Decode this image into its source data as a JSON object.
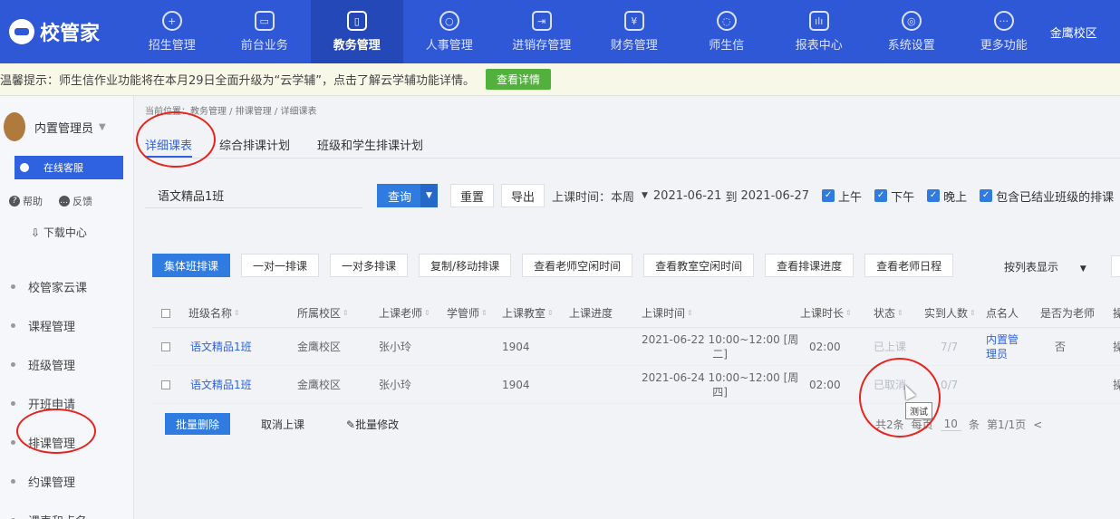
{
  "app": {
    "logo": "校管家",
    "campus": "金鹰校区"
  },
  "nav": [
    {
      "label": "招生管理",
      "icon": "user-plus-icon",
      "glyph": "+",
      "active": false
    },
    {
      "label": "前台业务",
      "icon": "monitor-icon",
      "glyph": "▭",
      "active": false
    },
    {
      "label": "教务管理",
      "icon": "book-icon",
      "glyph": "▯",
      "active": true
    },
    {
      "label": "人事管理",
      "icon": "person-icon",
      "glyph": "○",
      "active": false
    },
    {
      "label": "进销存管理",
      "icon": "inventory-icon",
      "glyph": "⇥",
      "active": false
    },
    {
      "label": "财务管理",
      "icon": "money-bag-icon",
      "glyph": "¥",
      "active": false
    },
    {
      "label": "师生信",
      "icon": "chat-icon",
      "glyph": "◌",
      "active": false
    },
    {
      "label": "报表中心",
      "icon": "report-chart-icon",
      "glyph": "ılı",
      "active": false
    },
    {
      "label": "系统设置",
      "icon": "gear-icon",
      "glyph": "◎",
      "active": false
    },
    {
      "label": "更多功能",
      "icon": "more-dots-icon",
      "glyph": "···",
      "active": false
    }
  ],
  "notice": {
    "text": "温馨提示：师生信作业功能将在本月29日全面升级为“云学辅”，点击了解云学辅功能详情。",
    "button": "查看详情"
  },
  "sidebar": {
    "user": "内置管理员",
    "service": "在线客服",
    "help": "帮助",
    "feedback": "反馈",
    "download": "下载中心",
    "menu": [
      "校管家云课",
      "课程管理",
      "班级管理",
      "开班申请",
      "排课管理",
      "约课管理",
      "课表和点名"
    ]
  },
  "breadcrumb": "当前位置：教务管理 / 排课管理 / 详细课表",
  "tabs": [
    "详细课表",
    "综合排课计划",
    "班级和学生排课计划"
  ],
  "filter": {
    "class_value": "语文精品1班",
    "query": "查询",
    "reset": "重置",
    "export": "导出",
    "time_label": "上课时间：本周",
    "date_from": "2021-06-21",
    "date_to_label": "到",
    "date_to": "2021-06-27",
    "checkboxes": [
      "上午",
      "下午",
      "晚上",
      "包含已结业班级的排课"
    ]
  },
  "actions": [
    "集体班排课",
    "一对一排课",
    "一对多排课",
    "复制/移动排课",
    "查看老师空闲时间",
    "查看教室空闲时间",
    "查看排课进度",
    "查看老师日程"
  ],
  "view_mode": "按列表显示",
  "table": {
    "headers": [
      "班级名称",
      "所属校区",
      "上课老师",
      "学管师",
      "上课教室",
      "上课进度",
      "上课时间",
      "上课时长",
      "状态",
      "实到人数",
      "点名人",
      "是否为老师",
      "操"
    ],
    "rows": [
      {
        "class": "语文精品1班",
        "campus": "金鹰校区",
        "teacher": "张小玲",
        "manager": "",
        "room": "1904",
        "progress": "",
        "time_line1": "2021-06-22 10:00~12:00 [周",
        "time_line2": "二]",
        "duration": "02:00",
        "status": "已上课",
        "attend": "7/7",
        "caller_line1": "内置管",
        "caller_line2": "理员",
        "is_teacher": "否",
        "op": "操"
      },
      {
        "class": "语文精品1班",
        "campus": "金鹰校区",
        "teacher": "张小玲",
        "manager": "",
        "room": "1904",
        "progress": "",
        "time_line1": "2021-06-24 10:00~12:00 [周",
        "time_line2": "四]",
        "duration": "02:00",
        "status": "已取消",
        "attend": "0/7",
        "caller_line1": "",
        "caller_line2": "",
        "is_teacher": "",
        "op": "操"
      }
    ]
  },
  "bottom": {
    "batch_delete": "批量删除",
    "cancel": "取消上课",
    "batch_edit": "✎批量修改"
  },
  "pager": {
    "total": "共2条",
    "per_page_label": "每页",
    "per_page": "10",
    "unit": "条",
    "page": "第1/1页",
    "prev": "<"
  },
  "tooltip": "测试",
  "colors": {
    "nav": "#2f58d6",
    "primary": "#2f7be0",
    "annotation": "#e8241e"
  }
}
